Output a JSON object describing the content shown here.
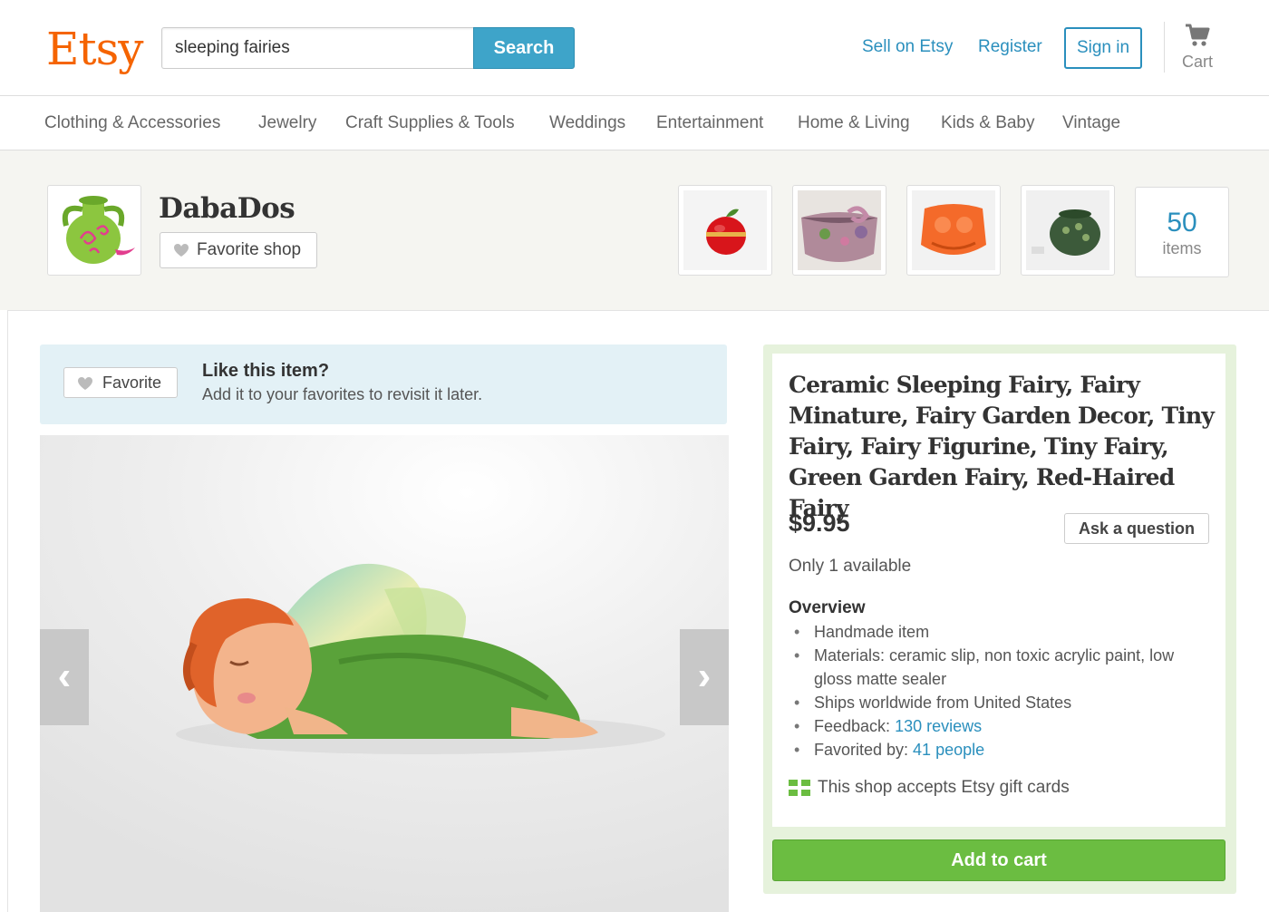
{
  "header": {
    "logo": "Etsy",
    "search_value": "sleeping fairies",
    "search_button": "Search",
    "sell_link": "Sell on Etsy",
    "register_link": "Register",
    "signin_button": "Sign in",
    "cart_label": "Cart"
  },
  "categories": [
    "Clothing & Accessories",
    "Jewelry",
    "Craft Supplies & Tools",
    "Weddings",
    "Entertainment",
    "Home & Living",
    "Kids & Baby",
    "Vintage"
  ],
  "shop": {
    "name": "DabaDos",
    "favorite_button": "Favorite shop",
    "items_count": "50",
    "items_label": "items"
  },
  "favorite_banner": {
    "button": "Favorite",
    "title": "Like this item?",
    "subtitle": "Add it to your favorites to revisit it later."
  },
  "listing": {
    "title": "Ceramic Sleeping Fairy, Fairy Minature, Fairy Garden Decor, Tiny Fairy, Fairy Figurine, Tiny Fairy, Green Garden Fairy, Red-Haired Fairy",
    "price": "$9.95",
    "ask_button": "Ask a question",
    "availability": "Only 1 available",
    "overview_title": "Overview",
    "overview": {
      "handmade": "Handmade item",
      "materials": "Materials: ceramic slip, non toxic acrylic paint, low gloss matte sealer",
      "ships": "Ships worldwide from United States",
      "feedback_label": "Feedback: ",
      "feedback_link": "130 reviews",
      "favorited_label": "Favorited by: ",
      "favorited_link": "41 people"
    },
    "giftcard_text": "This shop accepts Etsy gift cards",
    "add_to_cart": "Add to cart"
  },
  "colors": {
    "brand": "#f56400",
    "link": "#2a8fbd",
    "search_button": "#3ea4c9",
    "add_to_cart": "#6bbd41"
  }
}
